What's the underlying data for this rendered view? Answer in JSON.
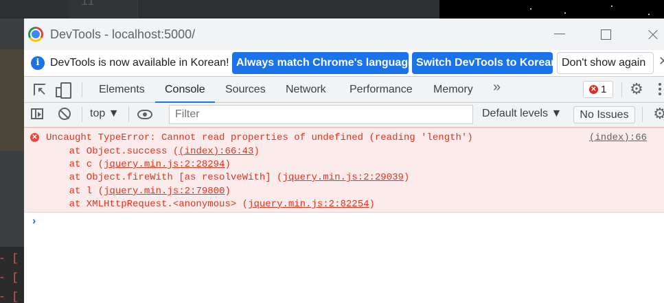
{
  "background": {
    "line_number": "11"
  },
  "window": {
    "title": "DevTools - localhost:5000/"
  },
  "infobar": {
    "message": "DevTools is now available in Korean!",
    "match_label": "Always match Chrome's language",
    "switch_label": "Switch DevTools to Korean",
    "dont_label": "Don't show again",
    "close_glyph": "✕"
  },
  "tabs": [
    "Elements",
    "Console",
    "Sources",
    "Network",
    "Performance",
    "Memory"
  ],
  "more_tabs": "»",
  "error_badge": {
    "count": "1"
  },
  "toolbar": {
    "context": "top ▼",
    "filter_placeholder": "Filter",
    "levels": "Default levels ▼",
    "issues": "No Issues"
  },
  "console": {
    "error_message": "Uncaught TypeError: Cannot read properties of undefined (reading 'length')",
    "source": "(index):66",
    "stack": [
      {
        "prefix": "    at Object.success (",
        "link": "(index):66:43",
        "suffix": ")"
      },
      {
        "prefix": "    at c (",
        "link": "jquery.min.js:2:28294",
        "suffix": ")"
      },
      {
        "prefix": "    at Object.fireWith [as resolveWith] (",
        "link": "jquery.min.js:2:29039",
        "suffix": ")"
      },
      {
        "prefix": "    at l (",
        "link": "jquery.min.js:2:79800",
        "suffix": ")"
      },
      {
        "prefix": "    at XMLHttpRequest.<anonymous> (",
        "link": "jquery.min.js:2:82254",
        "suffix": ")"
      }
    ],
    "prompt": "›"
  },
  "colors": {
    "accent": "#1a73e8",
    "error": "#e8311c",
    "error_bg": "#fcebeb"
  }
}
